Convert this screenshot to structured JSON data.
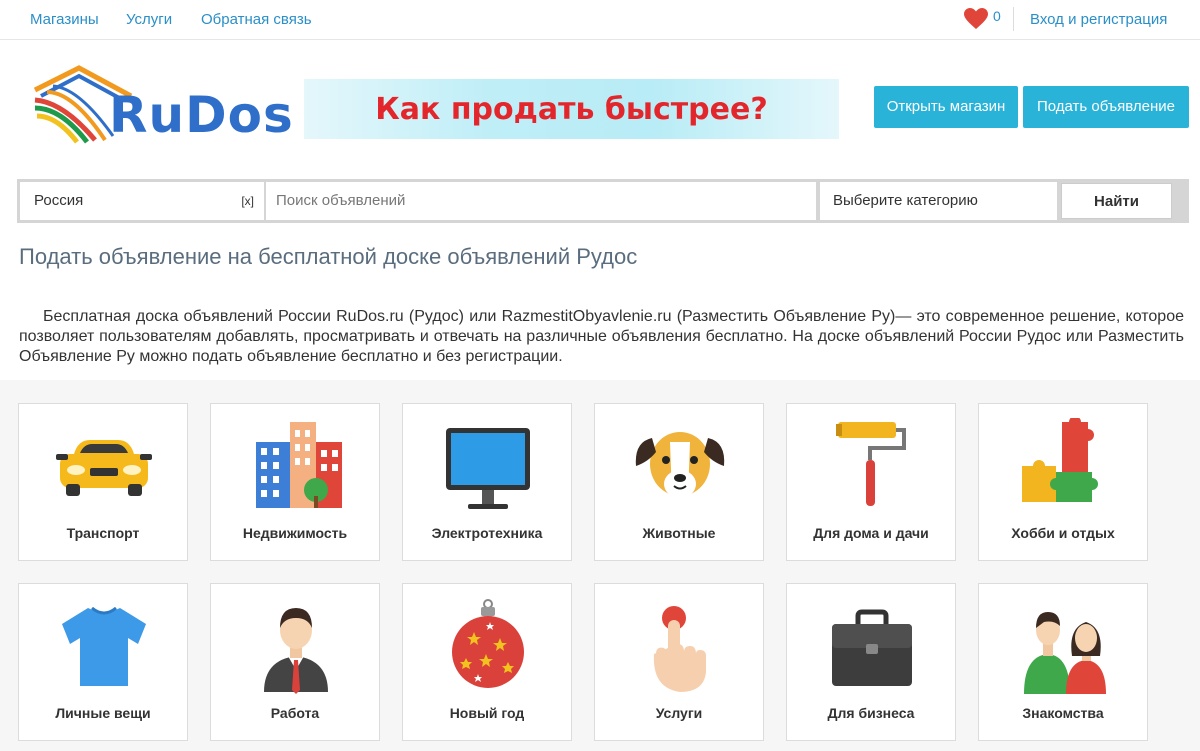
{
  "topnav": {
    "items": [
      "Магазины",
      "Услуги",
      "Обратная связь"
    ],
    "favorites_count": "0",
    "login_label": "Вход и регистрация"
  },
  "header": {
    "logo_text": "RuDos",
    "banner_text": "Как продать быстрее?",
    "open_shop_label": "Открыть магазин",
    "post_ad_label": "Подать объявление"
  },
  "search": {
    "region_value": "Россия",
    "clear_label": "[x]",
    "query_placeholder": "Поиск объявлений",
    "category_placeholder": "Выберите категорию",
    "find_label": "Найти"
  },
  "main": {
    "title": "Подать объявление на бесплатной доске объявлений Рудос",
    "intro": "Бесплатная доска объявлений России RuDos.ru (Рудос) или RazmestitObyavlenie.ru (Разместить Объявление Ру)— это современное решение, которое позволяет пользователям добавлять, просматривать и отвечать на различные объявления бесплатно. На доске объявлений России Рудос или Разместить Объявление Ру можно подать объявление бесплатно и без регистрации."
  },
  "categories": [
    {
      "label": "Транспорт",
      "icon": "car-icon"
    },
    {
      "label": "Недвижимость",
      "icon": "buildings-icon"
    },
    {
      "label": "Электротехника",
      "icon": "monitor-icon"
    },
    {
      "label": "Животные",
      "icon": "dog-icon"
    },
    {
      "label": "Для дома и дачи",
      "icon": "paint-roller-icon"
    },
    {
      "label": "Хобби и отдых",
      "icon": "puzzle-icon"
    },
    {
      "label": "Личные вещи",
      "icon": "tshirt-icon"
    },
    {
      "label": "Работа",
      "icon": "businessman-icon"
    },
    {
      "label": "Новый год",
      "icon": "christmas-ball-icon"
    },
    {
      "label": "Услуги",
      "icon": "pointing-hand-icon"
    },
    {
      "label": "Для бизнеса",
      "icon": "briefcase-icon"
    },
    {
      "label": "Знакомства",
      "icon": "couple-icon"
    }
  ],
  "colors": {
    "link": "#2a8fc9",
    "button": "#2ab3d8",
    "heart": "#e0453a",
    "banner_text": "#e3262b"
  }
}
